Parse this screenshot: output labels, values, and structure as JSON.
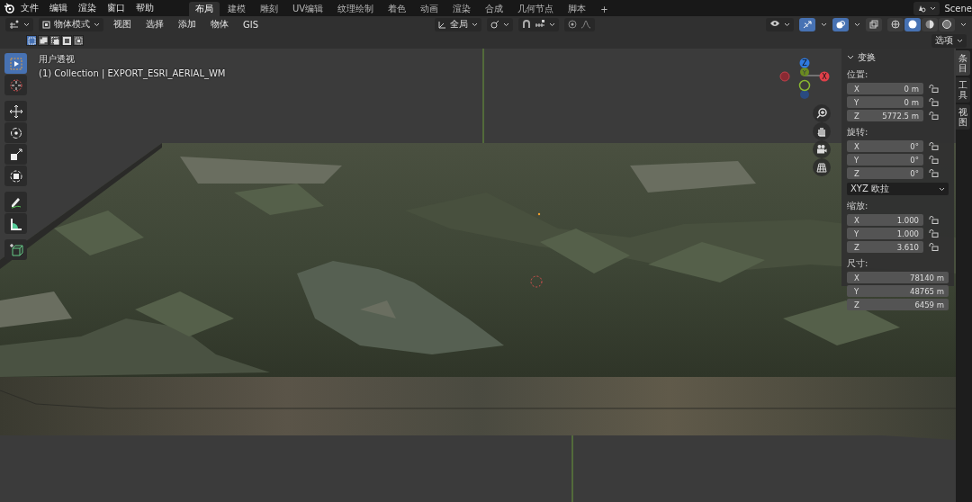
{
  "topbar": {
    "menus": [
      "文件",
      "编辑",
      "渲染",
      "窗口",
      "帮助"
    ],
    "workspaces": [
      {
        "label": "布局",
        "selected": true
      },
      {
        "label": "建模",
        "selected": false
      },
      {
        "label": "雕刻",
        "selected": false
      },
      {
        "label": "UV编辑",
        "selected": false
      },
      {
        "label": "纹理绘制",
        "selected": false
      },
      {
        "label": "着色",
        "selected": false
      },
      {
        "label": "动画",
        "selected": false
      },
      {
        "label": "渲染",
        "selected": false
      },
      {
        "label": "合成",
        "selected": false
      },
      {
        "label": "几何节点",
        "selected": false
      },
      {
        "label": "脚本",
        "selected": false
      }
    ],
    "add_tab": "+",
    "scene": "Scene"
  },
  "header": {
    "mode": "物体模式",
    "menus": [
      "视图",
      "选择",
      "添加",
      "物体",
      "GIS"
    ],
    "orientation": "全局",
    "gizmo_on": true,
    "overlays_on": true,
    "xray_on": false,
    "shading": [
      {
        "kind": "wire",
        "selected": false
      },
      {
        "kind": "solid",
        "selected": true
      },
      {
        "kind": "material",
        "selected": false
      },
      {
        "kind": "rendered",
        "selected": false
      }
    ],
    "options": "选项"
  },
  "select_modes": [
    {
      "kind": "new",
      "selected": true
    },
    {
      "kind": "extend",
      "selected": false
    },
    {
      "kind": "subtract",
      "selected": false
    },
    {
      "kind": "invert",
      "selected": false
    },
    {
      "kind": "intersect",
      "selected": false
    }
  ],
  "toolbar": [
    {
      "kind": "select",
      "selected": true
    },
    {
      "kind": "cursor",
      "selected": false
    },
    {
      "kind": "move",
      "selected": false
    },
    {
      "kind": "rotate",
      "selected": false
    },
    {
      "kind": "scale",
      "selected": false
    },
    {
      "kind": "transform",
      "selected": false
    },
    {
      "kind": "annotate",
      "selected": false
    },
    {
      "kind": "measure",
      "selected": false
    },
    {
      "kind": "add-cube",
      "selected": false
    }
  ],
  "viewport": {
    "view_name": "用户透视",
    "object_info": "(1) Collection | EXPORT_ESRI_AERIAL_WM",
    "gizmo_axes": [
      "Z",
      "Y",
      "X"
    ]
  },
  "sidebar": {
    "panel": "变换",
    "expanded": true,
    "sections": [
      {
        "kind": "vector",
        "label": "位置:",
        "locks": true,
        "rows": [
          {
            "axis": "X",
            "value": "0 m"
          },
          {
            "axis": "Y",
            "value": "0 m"
          },
          {
            "axis": "Z",
            "value": "5772.5 m"
          }
        ]
      },
      {
        "kind": "vector",
        "label": "旋转:",
        "locks": true,
        "rows": [
          {
            "axis": "X",
            "value": "0°"
          },
          {
            "axis": "Y",
            "value": "0°"
          },
          {
            "axis": "Z",
            "value": "0°"
          }
        ]
      },
      {
        "kind": "dropdown",
        "value": "XYZ 欧拉"
      },
      {
        "kind": "vector",
        "label": "缩放:",
        "locks": true,
        "rows": [
          {
            "axis": "X",
            "value": "1.000"
          },
          {
            "axis": "Y",
            "value": "1.000"
          },
          {
            "axis": "Z",
            "value": "3.610"
          }
        ]
      },
      {
        "kind": "vector",
        "label": "尺寸:",
        "locks": false,
        "rows": [
          {
            "axis": "X",
            "value": "78140 m"
          },
          {
            "axis": "Y",
            "value": "48765 m"
          },
          {
            "axis": "Z",
            "value": "6459 m"
          }
        ]
      }
    ],
    "tabs": [
      {
        "label": "条目",
        "selected": true
      },
      {
        "label": "工具",
        "selected": false
      },
      {
        "label": "视图",
        "selected": false
      }
    ]
  }
}
